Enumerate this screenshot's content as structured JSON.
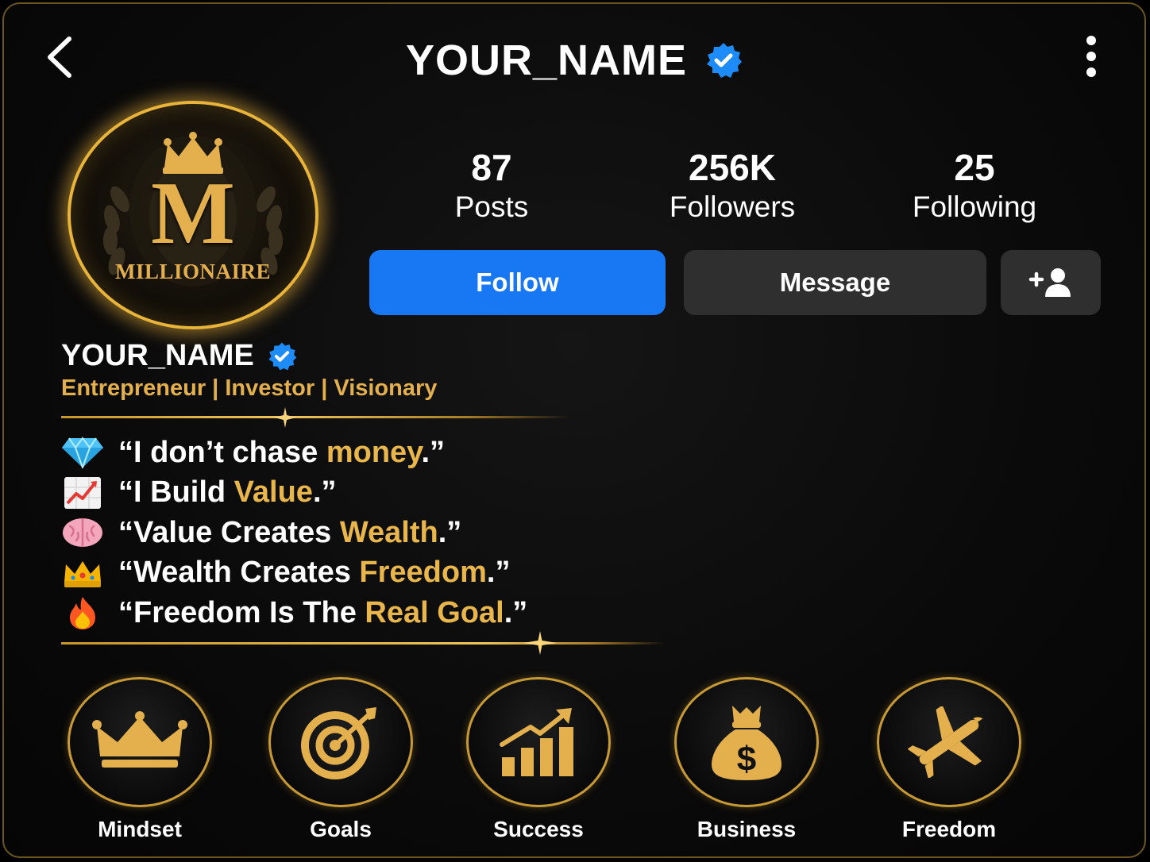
{
  "header": {
    "title": "YOUR_NAME",
    "verified": true
  },
  "profile": {
    "avatar": {
      "letter": "M",
      "word": "MILLIONAIRE"
    },
    "name": "YOUR_NAME",
    "tagline": "Entrepreneur | Investor | Visionary"
  },
  "stats": [
    {
      "value": "87",
      "label": "Posts"
    },
    {
      "value": "256K",
      "label": "Followers"
    },
    {
      "value": "25",
      "label": "Following"
    }
  ],
  "actions": {
    "follow": "Follow",
    "message": "Message"
  },
  "bio": [
    {
      "icon": "gem-icon",
      "before": "“I don’t chase ",
      "highlight": "money",
      "after": ".”"
    },
    {
      "icon": "chart-increasing-icon",
      "before": "“I Build ",
      "highlight": "Value",
      "after": ".”"
    },
    {
      "icon": "brain-icon",
      "before": "“Value Creates ",
      "highlight": "Wealth",
      "after": ".”"
    },
    {
      "icon": "crown-icon",
      "before": "“Wealth Creates ",
      "highlight": "Freedom",
      "after": ".”"
    },
    {
      "icon": "fire-icon",
      "before": "“Freedom Is The ",
      "highlight": "Real Goal",
      "after": ".”"
    }
  ],
  "highlights": [
    {
      "label": "Mindset",
      "icon": "crown-icon"
    },
    {
      "label": "Goals",
      "icon": "target-icon"
    },
    {
      "label": "Success",
      "icon": "growth-chart-icon"
    },
    {
      "label": "Business",
      "icon": "money-bag-icon"
    },
    {
      "label": "Freedom",
      "icon": "airplane-icon"
    }
  ],
  "colors": {
    "accent_gold": "#e8b64a",
    "follow_blue": "#1877f2",
    "button_gray": "#2f2f2f",
    "verified_blue": "#1d8cf8"
  }
}
